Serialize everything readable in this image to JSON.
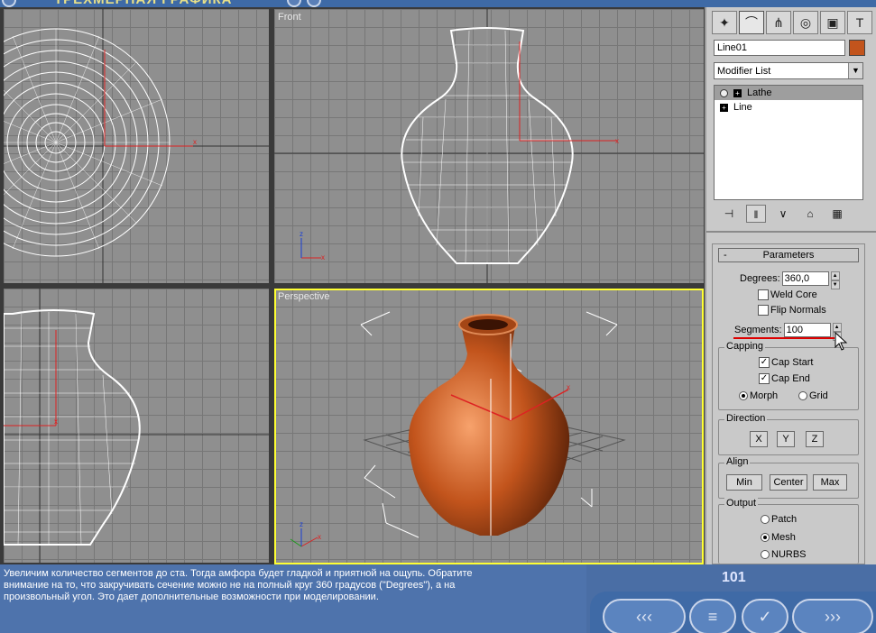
{
  "app": {
    "title": "ТРЕХМЕРНАЯ ГРАФИКА"
  },
  "viewports": {
    "front_label": "Front",
    "perspective_label": "Perspective"
  },
  "panel": {
    "tabs": [
      "create-icon",
      "modify-icon",
      "hierarchy-icon",
      "motion-icon",
      "display-icon",
      "utilities-icon"
    ],
    "object_name": "Line01",
    "object_color": "#c2541c",
    "modifier_list": "Modifier List",
    "stack": [
      {
        "label": "Lathe",
        "selected": true
      },
      {
        "label": "Line",
        "selected": false
      }
    ],
    "parameters": {
      "title": "Parameters",
      "degrees_label": "Degrees:",
      "degrees_value": "360,0",
      "weld_core": "Weld Core",
      "weld_core_checked": false,
      "flip_normals": "Flip Normals",
      "flip_normals_checked": false,
      "segments_label": "Segments:",
      "segments_value": "100",
      "capping": {
        "title": "Capping",
        "cap_start": "Cap Start",
        "cap_start_checked": true,
        "cap_end": "Cap End",
        "cap_end_checked": true,
        "morph": "Morph",
        "grid": "Grid",
        "selected": "Morph"
      },
      "direction": {
        "title": "Direction",
        "x": "X",
        "y": "Y",
        "z": "Z"
      },
      "align": {
        "title": "Align",
        "min": "Min",
        "center": "Center",
        "max": "Max"
      },
      "output": {
        "title": "Output",
        "patch": "Patch",
        "mesh": "Mesh",
        "nurbs": "NURBS",
        "selected": "Mesh"
      }
    }
  },
  "caption": {
    "line1": "Увеличим количество сегментов до ста. Тогда амфора будет гладкой и приятной на ощупь. Обратите",
    "line2": "внимание на то, что закручивать сечение можно не на полный круг 360 градусов (\"Degrees\"), а на",
    "line3": "произвольный угол. Это дает дополнительные возможности при моделировании."
  },
  "page_number": "101",
  "nav": {
    "back": "‹‹‹",
    "menu": "≡",
    "check": "✓",
    "forward": "›››"
  },
  "colors": {
    "vase": "#c2541c",
    "active_viewport": "#ffff33",
    "accent": "#4e73ac"
  }
}
